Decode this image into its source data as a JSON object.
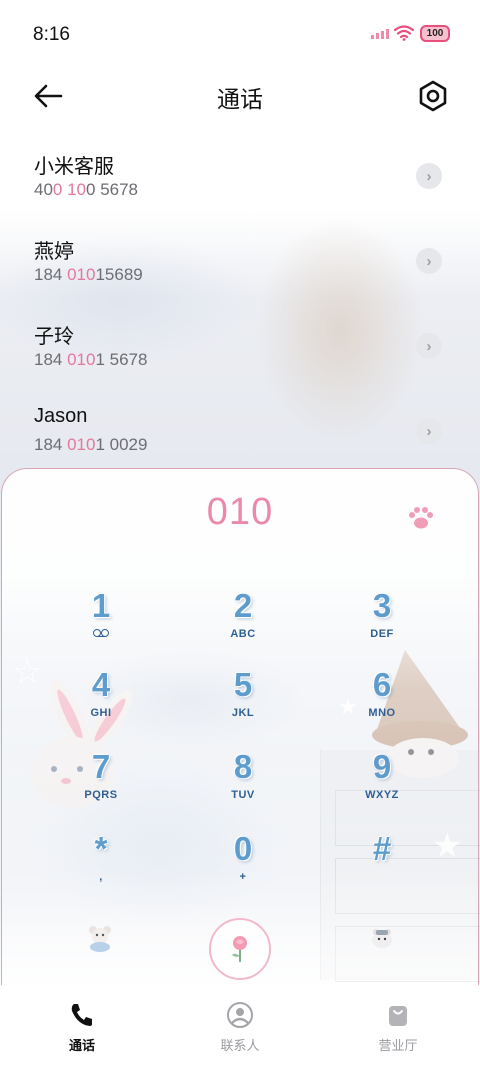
{
  "status_bar": {
    "time": "8:16",
    "battery": "100",
    "accent": "#e84f7c"
  },
  "header": {
    "title": "通话",
    "back_icon": "arrow-left-icon",
    "settings_icon": "gear-icon"
  },
  "contacts": [
    {
      "name": "小米客服",
      "num_pre": "40",
      "num_hl": "0 10",
      "num_post": "0 5678"
    },
    {
      "name": "燕婷",
      "num_pre": "184 ",
      "num_hl": "010",
      "num_post": "15689"
    },
    {
      "name": "子玲",
      "num_pre": "184 ",
      "num_hl": "010",
      "num_post": "1 5678"
    },
    {
      "name": "Jason",
      "num_pre": "184 ",
      "num_hl": "010",
      "num_post": "1 0029"
    }
  ],
  "dialpad": {
    "input": "010",
    "accent": "#ea89ab",
    "keys": [
      {
        "digit": "1",
        "letters": ""
      },
      {
        "digit": "2",
        "letters": "ABC"
      },
      {
        "digit": "3",
        "letters": "DEF"
      },
      {
        "digit": "4",
        "letters": "GHI"
      },
      {
        "digit": "5",
        "letters": "JKL"
      },
      {
        "digit": "6",
        "letters": "MNO"
      },
      {
        "digit": "7",
        "letters": "PQRS"
      },
      {
        "digit": "8",
        "letters": "TUV"
      },
      {
        "digit": "9",
        "letters": "WXYZ"
      },
      {
        "digit": "*",
        "letters": ","
      },
      {
        "digit": "0",
        "letters": "+"
      },
      {
        "digit": "#",
        "letters": ""
      }
    ]
  },
  "bottom_nav": {
    "tabs": [
      {
        "label": "通话",
        "icon": "phone-icon",
        "active": true
      },
      {
        "label": "联系人",
        "icon": "person-icon",
        "active": false
      },
      {
        "label": "营业厅",
        "icon": "bag-icon",
        "active": false
      }
    ]
  }
}
